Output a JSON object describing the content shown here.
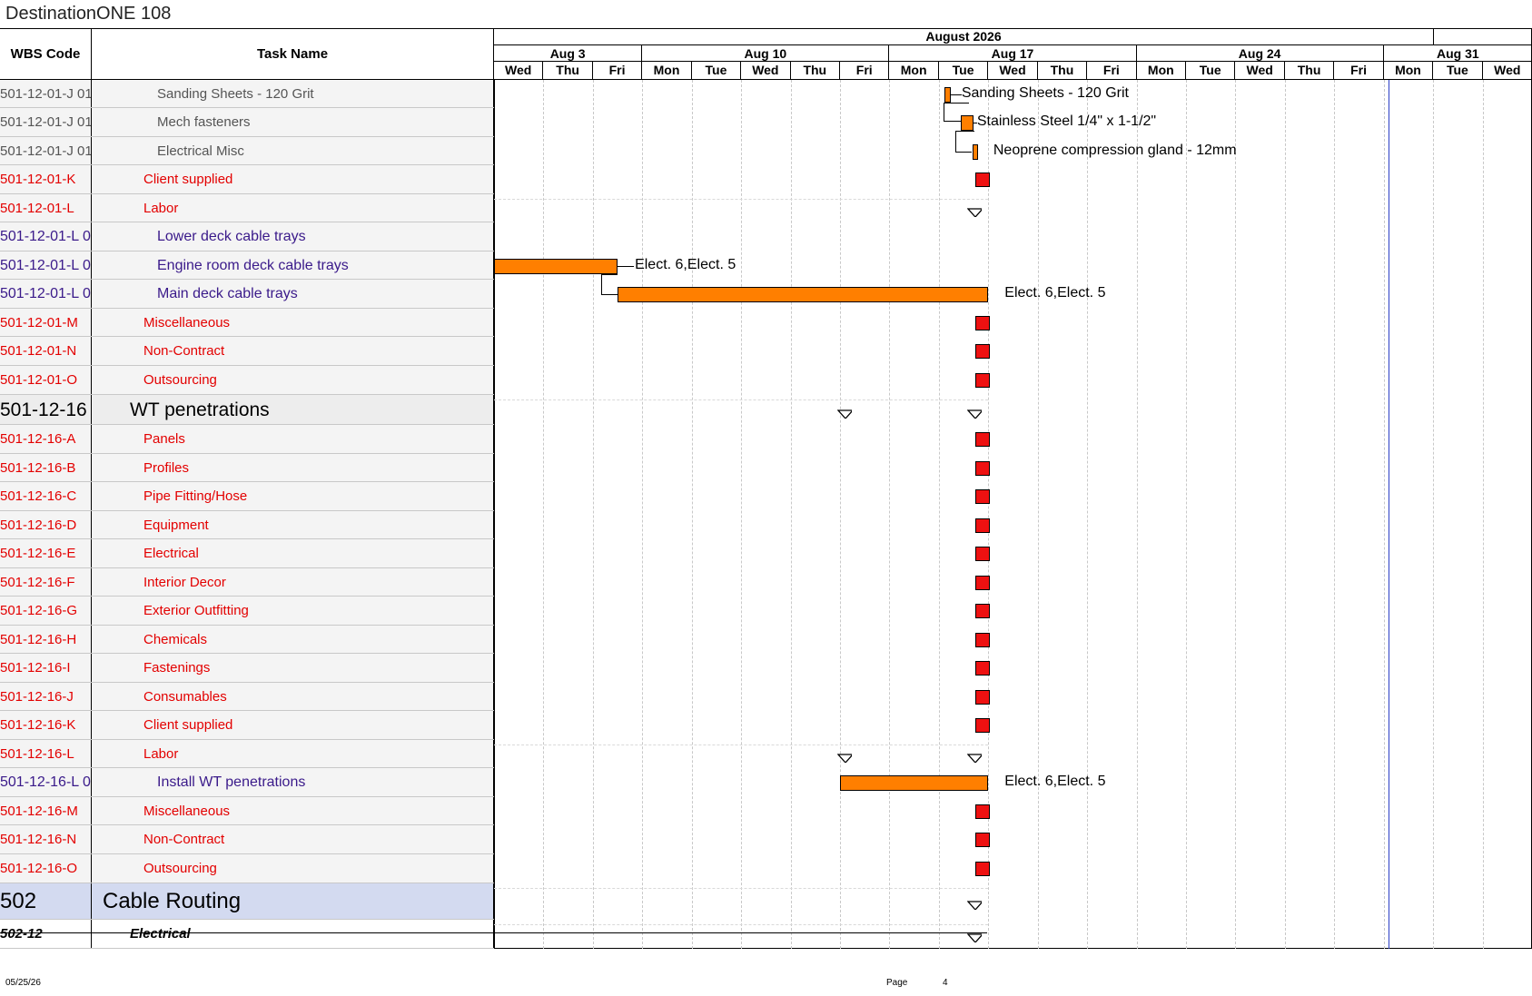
{
  "title": "DestinationONE 108",
  "header": {
    "wbs_label": "WBS Code",
    "task_label": "Task Name",
    "month": "August 2026",
    "weeks": [
      "Aug 3",
      "Aug 10",
      "Aug 17",
      "Aug 24",
      "Aug 31"
    ],
    "days": [
      "Wed",
      "Thu",
      "Fri",
      "Mon",
      "Tue",
      "Wed",
      "Thu",
      "Fri",
      "Mon",
      "Tue",
      "Wed",
      "Thu",
      "Fri",
      "Mon",
      "Tue",
      "Wed",
      "Thu",
      "Fri",
      "Mon",
      "Tue",
      "Wed"
    ]
  },
  "rows": [
    {
      "wbs": "501-12-01-J 01",
      "task": "Sanding Sheets - 120 Grit",
      "style": "gray",
      "indent": 3
    },
    {
      "wbs": "501-12-01-J 01",
      "task": "Mech fasteners",
      "style": "gray",
      "indent": 3
    },
    {
      "wbs": "501-12-01-J 01",
      "task": "Electrical Misc",
      "style": "gray",
      "indent": 3
    },
    {
      "wbs": "501-12-01-K",
      "task": "Client supplied",
      "style": "red",
      "indent": 2
    },
    {
      "wbs": "501-12-01-L",
      "task": "Labor",
      "style": "red",
      "indent": 2
    },
    {
      "wbs": "501-12-01-L 0",
      "task": "Lower deck cable trays",
      "style": "purple",
      "indent": 3
    },
    {
      "wbs": "501-12-01-L 0",
      "task": "Engine room deck cable trays",
      "style": "purple",
      "indent": 3
    },
    {
      "wbs": "501-12-01-L 0",
      "task": "Main deck cable trays",
      "style": "purple",
      "indent": 3
    },
    {
      "wbs": "501-12-01-M",
      "task": "Miscellaneous",
      "style": "red",
      "indent": 2
    },
    {
      "wbs": "501-12-01-N",
      "task": "Non-Contract",
      "style": "red",
      "indent": 2
    },
    {
      "wbs": "501-12-01-O",
      "task": "Outsourcing",
      "style": "red",
      "indent": 2
    },
    {
      "wbs": "501-12-16",
      "task": "WT penetrations",
      "style": "black-lg",
      "indent": 1
    },
    {
      "wbs": "501-12-16-A",
      "task": "Panels",
      "style": "red",
      "indent": 2
    },
    {
      "wbs": "501-12-16-B",
      "task": "Profiles",
      "style": "red",
      "indent": 2
    },
    {
      "wbs": "501-12-16-C",
      "task": "Pipe Fitting/Hose",
      "style": "red",
      "indent": 2
    },
    {
      "wbs": "501-12-16-D",
      "task": "Equipment",
      "style": "red",
      "indent": 2
    },
    {
      "wbs": "501-12-16-E",
      "task": "Electrical",
      "style": "red",
      "indent": 2
    },
    {
      "wbs": "501-12-16-F",
      "task": "Interior Decor",
      "style": "red",
      "indent": 2
    },
    {
      "wbs": "501-12-16-G",
      "task": "Exterior Outfitting",
      "style": "red",
      "indent": 2
    },
    {
      "wbs": "501-12-16-H",
      "task": "Chemicals",
      "style": "red",
      "indent": 2
    },
    {
      "wbs": "501-12-16-I",
      "task": "Fastenings",
      "style": "red",
      "indent": 2
    },
    {
      "wbs": "501-12-16-J",
      "task": "Consumables",
      "style": "red",
      "indent": 2
    },
    {
      "wbs": "501-12-16-K",
      "task": "Client supplied",
      "style": "red",
      "indent": 2
    },
    {
      "wbs": "501-12-16-L",
      "task": "Labor",
      "style": "red",
      "indent": 2
    },
    {
      "wbs": "501-12-16-L 0",
      "task": "Install WT penetrations",
      "style": "purple",
      "indent": 3
    },
    {
      "wbs": "501-12-16-M",
      "task": "Miscellaneous",
      "style": "red",
      "indent": 2
    },
    {
      "wbs": "501-12-16-N",
      "task": "Non-Contract",
      "style": "red",
      "indent": 2
    },
    {
      "wbs": "501-12-16-O",
      "task": "Outsourcing",
      "style": "red",
      "indent": 2
    },
    {
      "wbs": "502",
      "task": "Cable Routing",
      "style": "blue-lg",
      "indent": 0
    },
    {
      "wbs": "502-12",
      "task": "Electrical",
      "style": "black-bi",
      "indent": 1
    }
  ],
  "bar_labels": {
    "sanding": "Sanding Sheets - 120 Grit",
    "steel": "Stainless Steel 1/4\" x 1-1/2\"",
    "neoprene": "Neoprene compression gland - 12mm",
    "resources": "Elect. 6,Elect. 5"
  },
  "footer": {
    "date": "05/25/26",
    "page_label": "Page",
    "page_number": "4"
  },
  "colors": {
    "bar": "#ff7f00",
    "milestone": "#ee1111",
    "today_line": "#2b3fc7",
    "summary_blue": "#d3daf0"
  }
}
